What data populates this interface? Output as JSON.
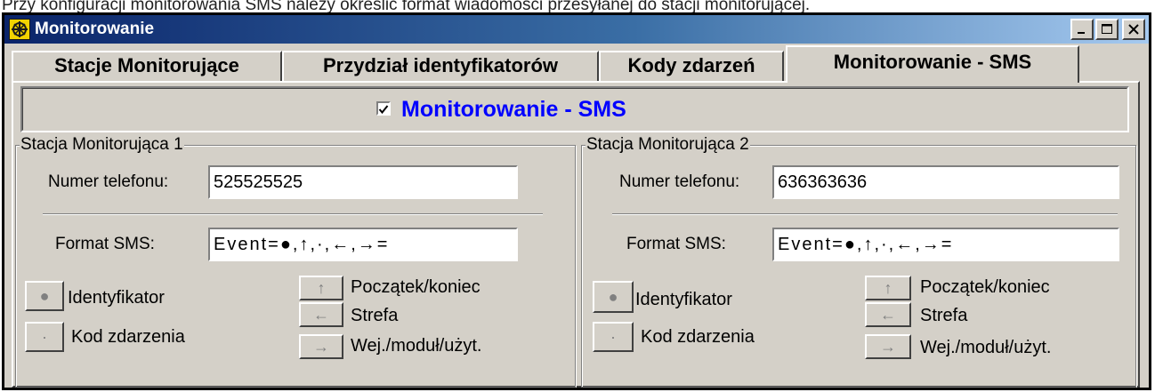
{
  "caption": "Przy konfiguracji monitorowania SMS należy określić format wiadomości przesyłanej do stacji monitorującej.",
  "window": {
    "title": "Monitorowanie",
    "minimize": "_",
    "maximize": "□",
    "close": "✕"
  },
  "tabs": [
    {
      "label": "Stacje Monitorujące"
    },
    {
      "label": "Przydział identyfikatorów"
    },
    {
      "label": "Kody zdarzeń"
    },
    {
      "label": "Monitorowanie - SMS",
      "active": true
    }
  ],
  "sms_enable": {
    "label": "Monitorowanie - SMS",
    "checked": true,
    "mark": "✔"
  },
  "stations": [
    {
      "title": "Stacja Monitorująca 1",
      "phone_label": "Numer telefonu:",
      "phone_value": "525525525",
      "format_label": "Format SMS:",
      "format_value": "Event=●,↑,·,←,→=",
      "buttons": {
        "identifier": {
          "glyph": "●",
          "label": "Identyfikator"
        },
        "event_code": {
          "glyph": "·",
          "label": "Kod zdarzenia"
        },
        "start_end": {
          "glyph": "↑",
          "label": "Początek/koniec"
        },
        "zone": {
          "glyph": "←",
          "label": "Strefa"
        },
        "input": {
          "glyph": "→",
          "label": "Wej./moduł/użyt."
        }
      }
    },
    {
      "title": "Stacja Monitorująca 2",
      "phone_label": "Numer telefonu:",
      "phone_value": "636363636",
      "format_label": "Format SMS:",
      "format_value": "Event=●,↑,·,←,→=",
      "buttons": {
        "identifier": {
          "glyph": "●",
          "label": "Identyfikator"
        },
        "event_code": {
          "glyph": "·",
          "label": "Kod zdarzenia"
        },
        "start_end": {
          "glyph": "↑",
          "label": "Początek/koniec"
        },
        "zone": {
          "glyph": "←",
          "label": "Strefa"
        },
        "input": {
          "glyph": "→",
          "label": "Wej./moduł/użyt."
        }
      }
    }
  ],
  "colors": {
    "titlebar_start": "#0a246a",
    "titlebar_end": "#a6caf0",
    "face": "#d4d0c8",
    "sms_label": "#0000ff",
    "app_icon": "#f2d300"
  }
}
